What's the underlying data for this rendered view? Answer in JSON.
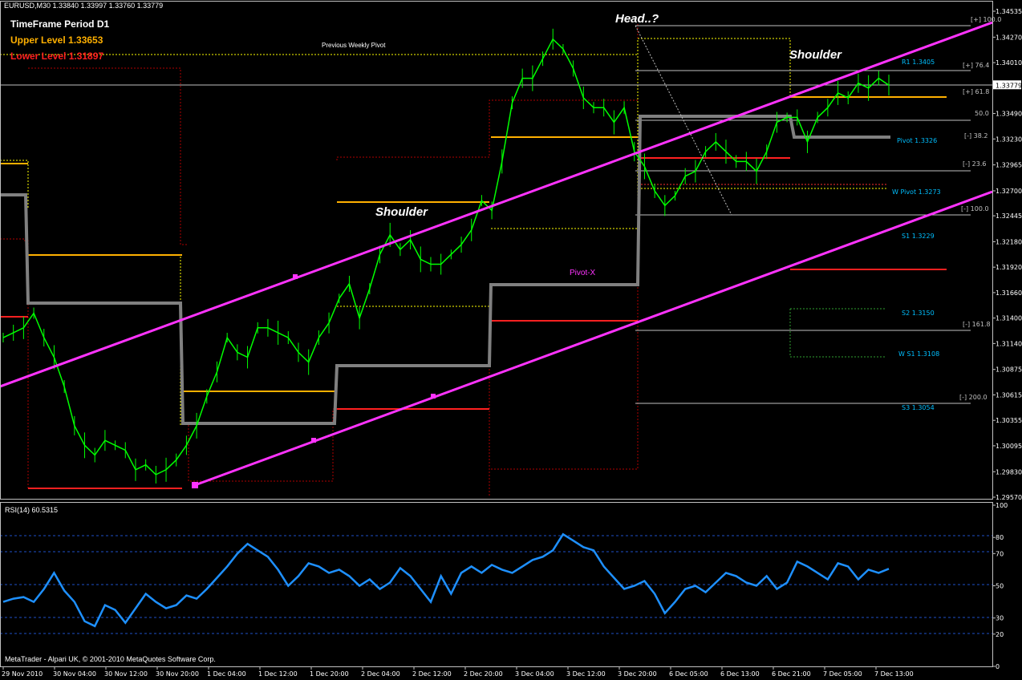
{
  "header": {
    "symbol_line": "EURUSD,M30  1.33840 1.33997 1.33760 1.33779",
    "timeframe": "TimeFrame Period D1",
    "upper_level": "Upper Level 1.33653",
    "lower_level": "Lower Level 1.31897"
  },
  "annotations": {
    "head": "Head..?",
    "shoulder_left": "Shoulder",
    "shoulder_right": "Shoulder",
    "previous_weekly_pivot": "Previous Weekly Pivot",
    "pivot_x": "Pivot-X"
  },
  "levels": [
    {
      "label": "[+] 100.0",
      "color": "#c0c0c0"
    },
    {
      "label": "R1  1.3405",
      "color": "#00bfff"
    },
    {
      "label": "[+] 76.4",
      "color": "#c0c0c0"
    },
    {
      "label": "[+]  61.8",
      "color": "#c0c0c0"
    },
    {
      "label": "50.0",
      "color": "#c0c0c0"
    },
    {
      "label": "[-]  38.2",
      "color": "#c0c0c0"
    },
    {
      "label": "Pivot  1.3326",
      "color": "#00bfff"
    },
    {
      "label": "[-]  23.6",
      "color": "#c0c0c0"
    },
    {
      "label": "W Pivot  1.3273",
      "color": "#00bfff"
    },
    {
      "label": "[-] 100.0",
      "color": "#c0c0c0"
    },
    {
      "label": "S1  1.3229",
      "color": "#00bfff"
    },
    {
      "label": "S2  1.3150",
      "color": "#00bfff"
    },
    {
      "label": "[-] 161.8",
      "color": "#c0c0c0"
    },
    {
      "label": "W S1  1.3108",
      "color": "#00bfff"
    },
    {
      "label": "[-]  200.0",
      "color": "#c0c0c0"
    },
    {
      "label": "S3  1.3054",
      "color": "#00bfff"
    }
  ],
  "rsi": {
    "label": "RSI(14) 60.5315"
  },
  "footer": {
    "copyright": "MetaTrader - Alpari UK, © 2001-2010 MetaQuotes Software Corp."
  },
  "chart_data": [
    {
      "type": "line",
      "title": "EURUSD,M30",
      "price_labels": [
        "1.34535",
        "1.34270",
        "1.34010",
        "1.33779",
        "1.33490",
        "1.33230",
        "1.32965",
        "1.32700",
        "1.32445",
        "1.32180",
        "1.31920",
        "1.31660",
        "1.31400",
        "1.31140",
        "1.30875",
        "1.30615",
        "1.30355",
        "1.30095",
        "1.29830",
        "1.29570"
      ],
      "current_price": "1.33779",
      "ylim": [
        1.2957,
        1.34535
      ],
      "x_ticks": [
        "29 Nov 2010",
        "30 Nov 04:00",
        "30 Nov 12:00",
        "30 Nov 20:00",
        "1 Dec 04:00",
        "1 Dec 12:00",
        "1 Dec 20:00",
        "2 Dec 04:00",
        "2 Dec 12:00",
        "2 Dec 20:00",
        "3 Dec 04:00",
        "3 Dec 12:00",
        "3 Dec 20:00",
        "6 Dec 05:00",
        "6 Dec 13:00",
        "6 Dec 21:00",
        "7 Dec 05:00",
        "7 Dec 13:00"
      ],
      "series": [
        {
          "name": "EURUSD,M30",
          "color": "#00ff00",
          "x": [
            0,
            1,
            2,
            3,
            4,
            5,
            6,
            7,
            8,
            9,
            10,
            11,
            12,
            13,
            14,
            15,
            16,
            17,
            18,
            19,
            20,
            21,
            22,
            23,
            24,
            25,
            26,
            27,
            28,
            29,
            30,
            31,
            32,
            33,
            34,
            35,
            36,
            37,
            38,
            39,
            40,
            41,
            42,
            43,
            44,
            45,
            46,
            47,
            48,
            49,
            50,
            51,
            52,
            53,
            54,
            55,
            56,
            57,
            58,
            59,
            60,
            61,
            62,
            63,
            64,
            65,
            66,
            67,
            68,
            69,
            70,
            71,
            72,
            73,
            74,
            75,
            76,
            77,
            78,
            79,
            80,
            81,
            82,
            83,
            84,
            85,
            86,
            87
          ],
          "values": [
            1.312,
            1.3125,
            1.313,
            1.3145,
            1.312,
            1.31,
            1.307,
            1.303,
            1.301,
            1.3,
            1.3015,
            1.301,
            1.3005,
            1.2985,
            1.299,
            1.298,
            1.2985,
            1.2995,
            1.301,
            1.303,
            1.306,
            1.3085,
            1.312,
            1.3105,
            1.31,
            1.313,
            1.313,
            1.3125,
            1.312,
            1.3105,
            1.3095,
            1.312,
            1.3135,
            1.316,
            1.3175,
            1.314,
            1.317,
            1.3205,
            1.3225,
            1.321,
            1.322,
            1.32,
            1.3195,
            1.3195,
            1.3205,
            1.3215,
            1.323,
            1.326,
            1.325,
            1.33,
            1.336,
            1.3385,
            1.3385,
            1.3405,
            1.3425,
            1.3415,
            1.3395,
            1.3365,
            1.3355,
            1.3355,
            1.334,
            1.3355,
            1.331,
            1.3295,
            1.327,
            1.3255,
            1.3265,
            1.3285,
            1.329,
            1.331,
            1.332,
            1.331,
            1.33,
            1.33,
            1.329,
            1.331,
            1.334,
            1.3345,
            1.3345,
            1.332,
            1.3345,
            1.3355,
            1.337,
            1.3365,
            1.338,
            1.3375,
            1.3385,
            1.3378
          ]
        }
      ]
    },
    {
      "type": "line",
      "title": "RSI(14) 60.5315",
      "y_ticks": [
        100,
        80,
        70,
        50,
        30,
        20,
        0
      ],
      "ylim": [
        0,
        100
      ],
      "series": [
        {
          "name": "RSI(14)",
          "color": "#1e90ff",
          "x": [
            0,
            1,
            2,
            3,
            4,
            5,
            6,
            7,
            8,
            9,
            10,
            11,
            12,
            13,
            14,
            15,
            16,
            17,
            18,
            19,
            20,
            21,
            22,
            23,
            24,
            25,
            26,
            27,
            28,
            29,
            30,
            31,
            32,
            33,
            34,
            35,
            36,
            37,
            38,
            39,
            40,
            41,
            42,
            43,
            44,
            45,
            46,
            47,
            48,
            49,
            50,
            51,
            52,
            53,
            54,
            55,
            56,
            57,
            58,
            59,
            60,
            61,
            62,
            63,
            64,
            65,
            66,
            67,
            68,
            69,
            70,
            71,
            72,
            73,
            74,
            75,
            76,
            77,
            78,
            79,
            80,
            81,
            82,
            83,
            84,
            85,
            86,
            87
          ],
          "values": [
            40,
            42,
            43,
            40,
            48,
            58,
            47,
            40,
            28,
            25,
            38,
            35,
            27,
            36,
            45,
            40,
            36,
            38,
            44,
            42,
            48,
            55,
            62,
            70,
            76,
            72,
            68,
            60,
            50,
            56,
            64,
            62,
            58,
            60,
            56,
            50,
            54,
            48,
            52,
            61,
            56,
            48,
            40,
            56,
            45,
            58,
            62,
            58,
            63,
            60,
            58,
            62,
            66,
            68,
            72,
            82,
            78,
            74,
            72,
            62,
            55,
            48,
            50,
            53,
            45,
            33,
            40,
            48,
            50,
            46,
            52,
            58,
            56,
            52,
            50,
            56,
            48,
            52,
            65,
            62,
            58,
            54,
            64,
            62,
            54,
            60,
            58,
            60.53
          ]
        }
      ]
    }
  ]
}
